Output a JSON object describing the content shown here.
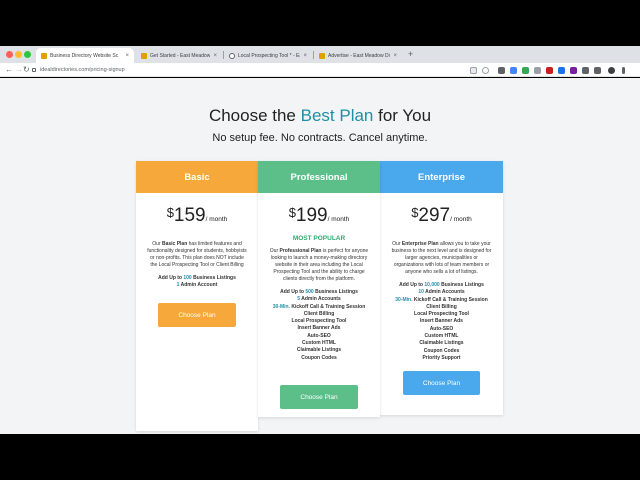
{
  "browser": {
    "tabs": [
      {
        "title": "Business Directory Website Sc",
        "active": true
      },
      {
        "title": "Get Started - East Meadow Dr",
        "active": false
      },
      {
        "title": "Local Prospecting Tool * - East",
        "active": false
      },
      {
        "title": "Advertise - East Meadow Dire",
        "active": false
      }
    ],
    "close_glyph": "×",
    "new_tab_glyph": "+",
    "url": "idealdirectories.com/pricing-signup",
    "back_glyph": "←",
    "forward_glyph": "→",
    "reload_glyph": "↻"
  },
  "page": {
    "headline_prefix": "Choose the ",
    "headline_accent": "Best Plan",
    "headline_suffix": " for You",
    "subhead": "No setup fee. No contracts. Cancel anytime.",
    "currency": "$",
    "per_month": "/ month"
  },
  "plans": {
    "basic": {
      "name": "Basic",
      "price": "159",
      "desc_pre": "Our ",
      "desc_bold": "Basic Plan",
      "desc_post": " has limited features and functionality designed for students, hobbyists or non-profits. This plan does NOT include the Local Prospecting Tool or Client Billing",
      "listings_pre": "Add Up to ",
      "listings_num": "100",
      "listings_post": " Business Listings",
      "admin_num": "1",
      "admin_post": " Admin Account",
      "button": "Choose Plan",
      "color": "#f7a83a"
    },
    "professional": {
      "name": "Professional",
      "price": "199",
      "badge": "MOST POPULAR",
      "desc_pre": "Our ",
      "desc_bold": "Professional Plan",
      "desc_post": " is perfect for anyone looking to launch a money-making directory website in their area including the Local Prospecting Tool and the ability to charge clients directly from the platform.",
      "listings_pre": "Add Up to ",
      "listings_num": "500",
      "listings_post": " Business Listings",
      "admin_num": "5",
      "admin_post": " Admin Accounts",
      "kickoff_num": "30-Min.",
      "kickoff_post": " Kickoff Call & Training Session",
      "features": [
        "Client Billing",
        "Local Prospecting Tool",
        "Insert Banner Ads",
        "Auto-SEO",
        "Custom HTML",
        "Claimable Listings",
        "Coupon Codes"
      ],
      "button": "Choose Plan",
      "color": "#5cbf8a"
    },
    "enterprise": {
      "name": "Enterprise",
      "price": "297",
      "desc_pre": "Our ",
      "desc_bold": "Enterprise Plan",
      "desc_post": " allows you to take your business to the next level and is designed for larger agencies, municipalities or organizations with lots of team members or anyone who sells a lot of listings.",
      "listings_pre": "Add Up to ",
      "listings_num": "10,000",
      "listings_post": " Business Listings",
      "admin_num": "10",
      "admin_post": " Admin Accounts",
      "kickoff_num": "30-Min.",
      "kickoff_post": " Kickoff Call & Training Session",
      "features": [
        "Client Billing",
        "Local Prospecting Tool",
        "Insert Banner Ads",
        "Auto-SEO",
        "Custom HTML",
        "Claimable Listings",
        "Coupon Codes",
        "Priority Support"
      ],
      "button": "Choose Plan",
      "color": "#4aa8ec"
    }
  }
}
